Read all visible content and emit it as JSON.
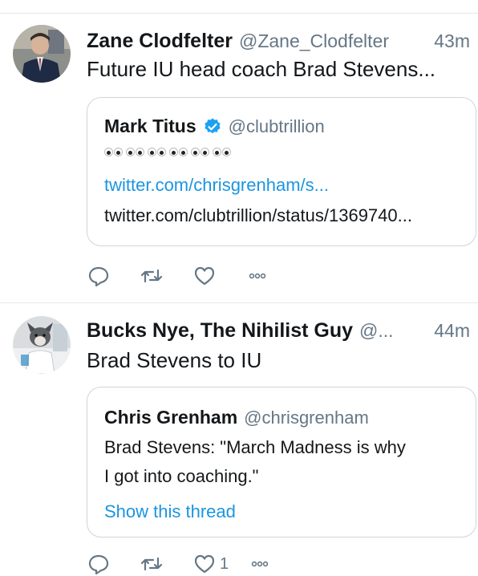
{
  "tweets": [
    {
      "name": "Zane Clodfelter",
      "handle": "@Zane_Clodfelter",
      "time": "43m",
      "text": "Future IU head coach Brad Stevens...",
      "quote": {
        "name": "Mark Titus",
        "handle": "@clubtrillion",
        "verified": true,
        "emoji_icon": "eyes-emoji-row",
        "link": "twitter.com/chrisgrenham/s...",
        "url_text": "twitter.com/clubtrillion/status/1369740..."
      },
      "actions": {
        "reply_icon": "reply-icon",
        "retweet_icon": "retweet-icon",
        "like_icon": "like-icon",
        "like_count": "",
        "more_icon": "more-icon"
      }
    },
    {
      "name": "Bucks Nye, The Nihilist Guy",
      "handle": "@...",
      "time": "44m",
      "text": "Brad Stevens to IU",
      "quote": {
        "name": "Chris Grenham",
        "handle": "@chrisgrenham",
        "line1": "Brad Stevens: \"March Madness is why",
        "line2": "I got into coaching.\"",
        "thread_link": "Show this thread"
      },
      "actions": {
        "reply_icon": "reply-icon",
        "retweet_icon": "retweet-icon",
        "like_icon": "like-icon",
        "like_count": "1",
        "more_icon": "more-icon"
      }
    }
  ],
  "colors": {
    "link": "#1b95e0",
    "muted": "#657786",
    "verified": "#1da1f2",
    "border": "#ccd6dd"
  }
}
